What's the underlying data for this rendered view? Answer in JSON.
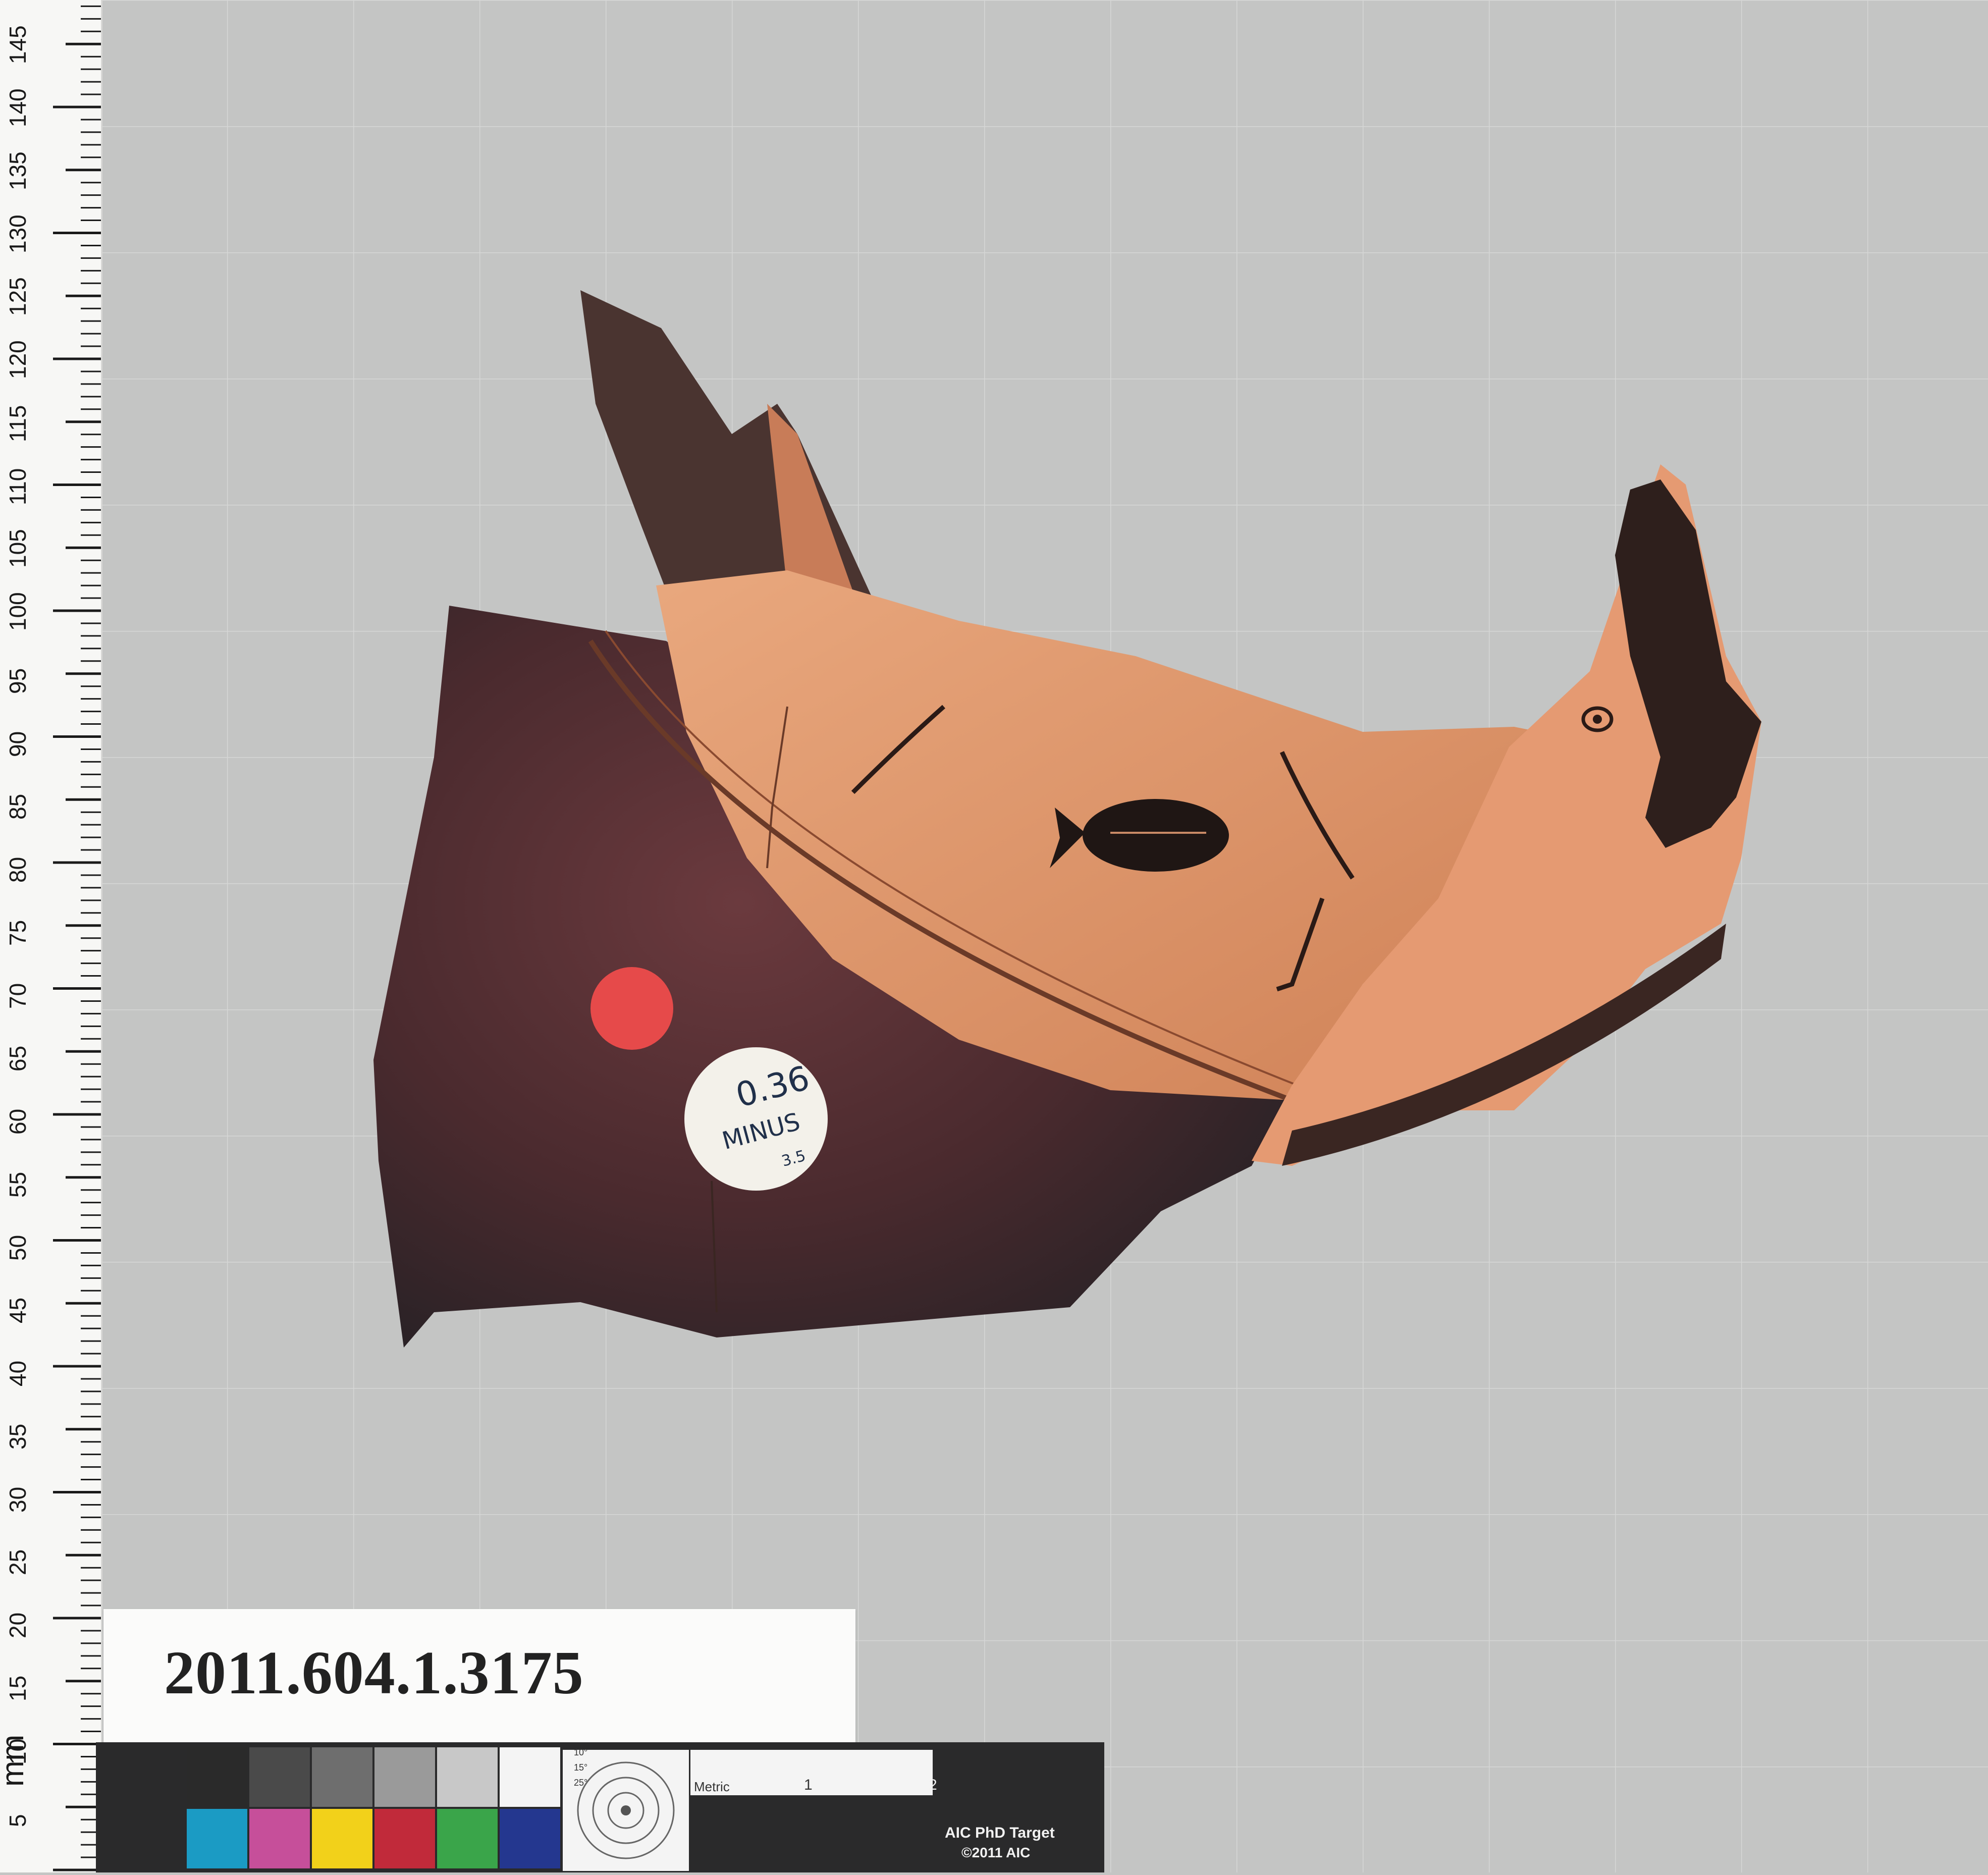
{
  "ruler": {
    "unit_label": "mm",
    "ticks": [
      "5",
      "10",
      "15",
      "20",
      "25",
      "30",
      "35",
      "40",
      "45",
      "50",
      "55",
      "60",
      "65",
      "70",
      "75",
      "80",
      "85",
      "90",
      "95",
      "100",
      "105",
      "110",
      "115",
      "120",
      "125",
      "130",
      "135",
      "140",
      "145"
    ]
  },
  "label_card": {
    "accession_number": "2011.604.1.3175"
  },
  "sticker": {
    "line1": "0.36",
    "line2": "MINUS",
    "line3": "3.5"
  },
  "target": {
    "metric_label": "Metric",
    "scale_marks": [
      "1",
      "2"
    ],
    "angles": [
      "10°",
      "15°",
      "25°"
    ],
    "title": "AIC PhD Target",
    "copyright": "©2011 AIC"
  },
  "colors": {
    "background": "#c4c5c4",
    "grid_lines": "#d6d7d6",
    "terracotta": "#d98f66",
    "black_glaze": "#3a2522",
    "red_dot": "#e64a4a",
    "color_patches": [
      "#2a2a2a",
      "#4a4a4a",
      "#6e6e6e",
      "#9a9a9a",
      "#c8c8c8",
      "#f4f4f4",
      "#1b9bc4",
      "#c64f9a",
      "#f2d11a",
      "#c12a3a",
      "#3aa54a",
      "#24378f"
    ]
  }
}
